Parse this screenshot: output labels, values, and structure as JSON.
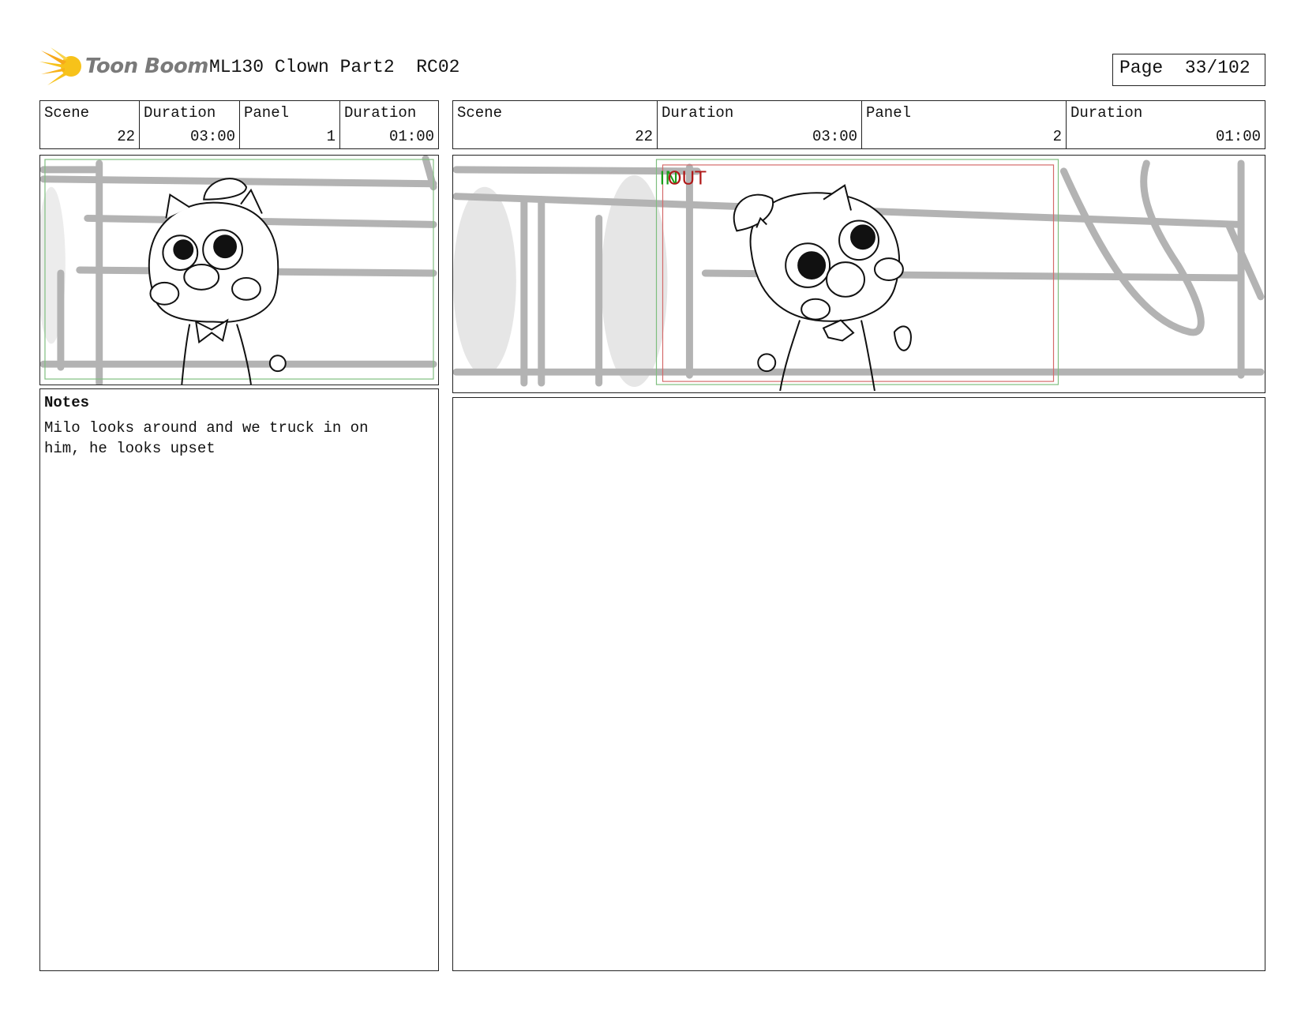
{
  "header": {
    "logo_text": "Toon Boom",
    "doc_title": "ML130 Clown Part2  RC02",
    "page_label": "Page",
    "page_number": "33/102"
  },
  "panel_left": {
    "scene_label": "Scene",
    "scene_value": "22",
    "scene_duration_label": "Duration",
    "scene_duration_value": "03:00",
    "panel_label": "Panel",
    "panel_value": "1",
    "panel_duration_label": "Duration",
    "panel_duration_value": "01:00"
  },
  "panel_right": {
    "scene_label": "Scene",
    "scene_value": "22",
    "scene_duration_label": "Duration",
    "scene_duration_value": "03:00",
    "panel_label": "Panel",
    "panel_value": "2",
    "panel_duration_label": "Duration",
    "panel_duration_value": "01:00",
    "in_label": "IN",
    "out_label": "OUT"
  },
  "notes": {
    "title": "Notes",
    "text": "Milo looks around and we truck in on\nhim, he looks upset"
  },
  "colors": {
    "logo_accent": "#f7c21a",
    "in_marker": "#1a9e1a",
    "out_marker": "#b01818",
    "sketch_gray": "#b3b3b3"
  }
}
